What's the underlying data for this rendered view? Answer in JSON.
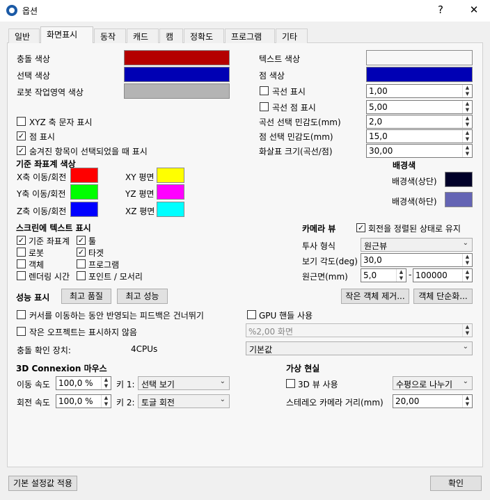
{
  "window": {
    "title": "옵션",
    "help": "?",
    "close": "✕"
  },
  "tabs": [
    "일반",
    "화면표시",
    "동작",
    "캐드",
    "캠",
    "정확도",
    "프로그램",
    "기타"
  ],
  "colors_left": {
    "collision": "충돌 색상",
    "selection": "선택 색상",
    "robot_workspace": "로봇 작업영역 색상"
  },
  "colors_right": {
    "text": "텍스트 색상",
    "point": "점 색상"
  },
  "swatch_colors": {
    "collision": "#b40000",
    "selection": "#0000b4",
    "robot_workspace": "#b4b4b4",
    "text": "#f7f7f7",
    "point": "#0000b4",
    "x_axis": "#ff0000",
    "y_axis": "#00ff00",
    "z_axis": "#0000ff",
    "xy_plane": "#ffff00",
    "yz_plane": "#ff00ff",
    "xz_plane": "#00ffff",
    "bg_top": "#000028",
    "bg_bottom": "#6464b4"
  },
  "curve_options": {
    "show_curve": "곡선 표시",
    "show_curve_value": "1,00",
    "show_curve_points": "곡선 점 표시",
    "show_curve_points_value": "5,00",
    "curve_sensitivity": "곡선 선택 민감도(mm)",
    "curve_sensitivity_value": "2,0",
    "point_sensitivity": "점 선택 민감도(mm)",
    "point_sensitivity_value": "15,0",
    "arrow_size": "화살표 크기(곡선/점)",
    "arrow_size_value": "30,00"
  },
  "display_checks": {
    "xyz_axis_text": "XYZ 축 문자 표시",
    "show_points": "점 표시",
    "show_hidden_selected": "숨겨진 항목이 선택되었을 때 표시"
  },
  "reference_frame": {
    "heading": "기준 좌표계 색상",
    "x": "X축 이동/회전",
    "y": "Y축 이동/회전",
    "z": "Z축 이동/회전",
    "xy": "XY 평면",
    "yz": "YZ 평면",
    "xz": "XZ 평면"
  },
  "background": {
    "heading": "배경색",
    "top": "배경색(상단)",
    "bottom": "배경색(하단)"
  },
  "screen_text": {
    "heading": "스크린에 텍스트 표시",
    "ref_frame": "기준 좌표계",
    "tool": "툴",
    "robot": "로봇",
    "target": "타겟",
    "object": "객체",
    "program": "프로그램",
    "render_time": "렌더링 시간",
    "point_surface": "포인트 / 모서리"
  },
  "camera": {
    "heading": "카메라 뷰",
    "keep_level": "회전을 정렬된 상태로 유지",
    "projection": "투사 형식",
    "projection_value": "원근뷰",
    "fov": "보기 각도(deg)",
    "fov_value": "30,0",
    "near_far": "원근면(mm)",
    "near_value": "5,0",
    "dash": "-",
    "far_value": "100000"
  },
  "performance": {
    "heading": "성능 표시",
    "best_quality": "최고 품질",
    "best_performance": "최고 성능",
    "remove_small": "작은 객체 제거...",
    "simplify": "객체 단순화...",
    "skip_feedback": "커서를 이동하는 동안 반영되는 피드백은 건너뛰기",
    "hide_small": "작은 오프젝트는 표시하지 않음",
    "gpu_handle": "GPU 핸들 사용",
    "screen_percent": "%2,00 화면",
    "collision_device": "충돌 확인 장치:",
    "cpus": "4CPUs",
    "device_value": "기본값"
  },
  "mouse": {
    "heading": "3D Connexion 마우스",
    "move_speed": "이동 속도",
    "move_speed_value": "100,0 %",
    "rotate_speed": "회전 속도",
    "rotate_speed_value": "100,0 %",
    "key1": "키 1:",
    "key1_value": "선택 보기",
    "key2": "키 2:",
    "key2_value": "토글 회전"
  },
  "vr": {
    "heading": "가상 현실",
    "use_3d": "3D 뷰 사용",
    "split_value": "수평으로 나누기",
    "stereo_distance": "스테레오 카메라 거리(mm)",
    "stereo_value": "20,00"
  },
  "footer": {
    "apply_defaults": "기본 설정값 적용",
    "ok": "확인"
  },
  "checks_state": {
    "show_curve": false,
    "show_curve_points": false,
    "xyz_axis_text": false,
    "show_points": true,
    "show_hidden_selected": true,
    "ref_frame": true,
    "tool": true,
    "robot": false,
    "target": true,
    "object": false,
    "program": false,
    "render_time": false,
    "point_surface": false,
    "keep_level": true,
    "skip_feedback": false,
    "hide_small": false,
    "gpu_handle": false,
    "use_3d": false
  }
}
